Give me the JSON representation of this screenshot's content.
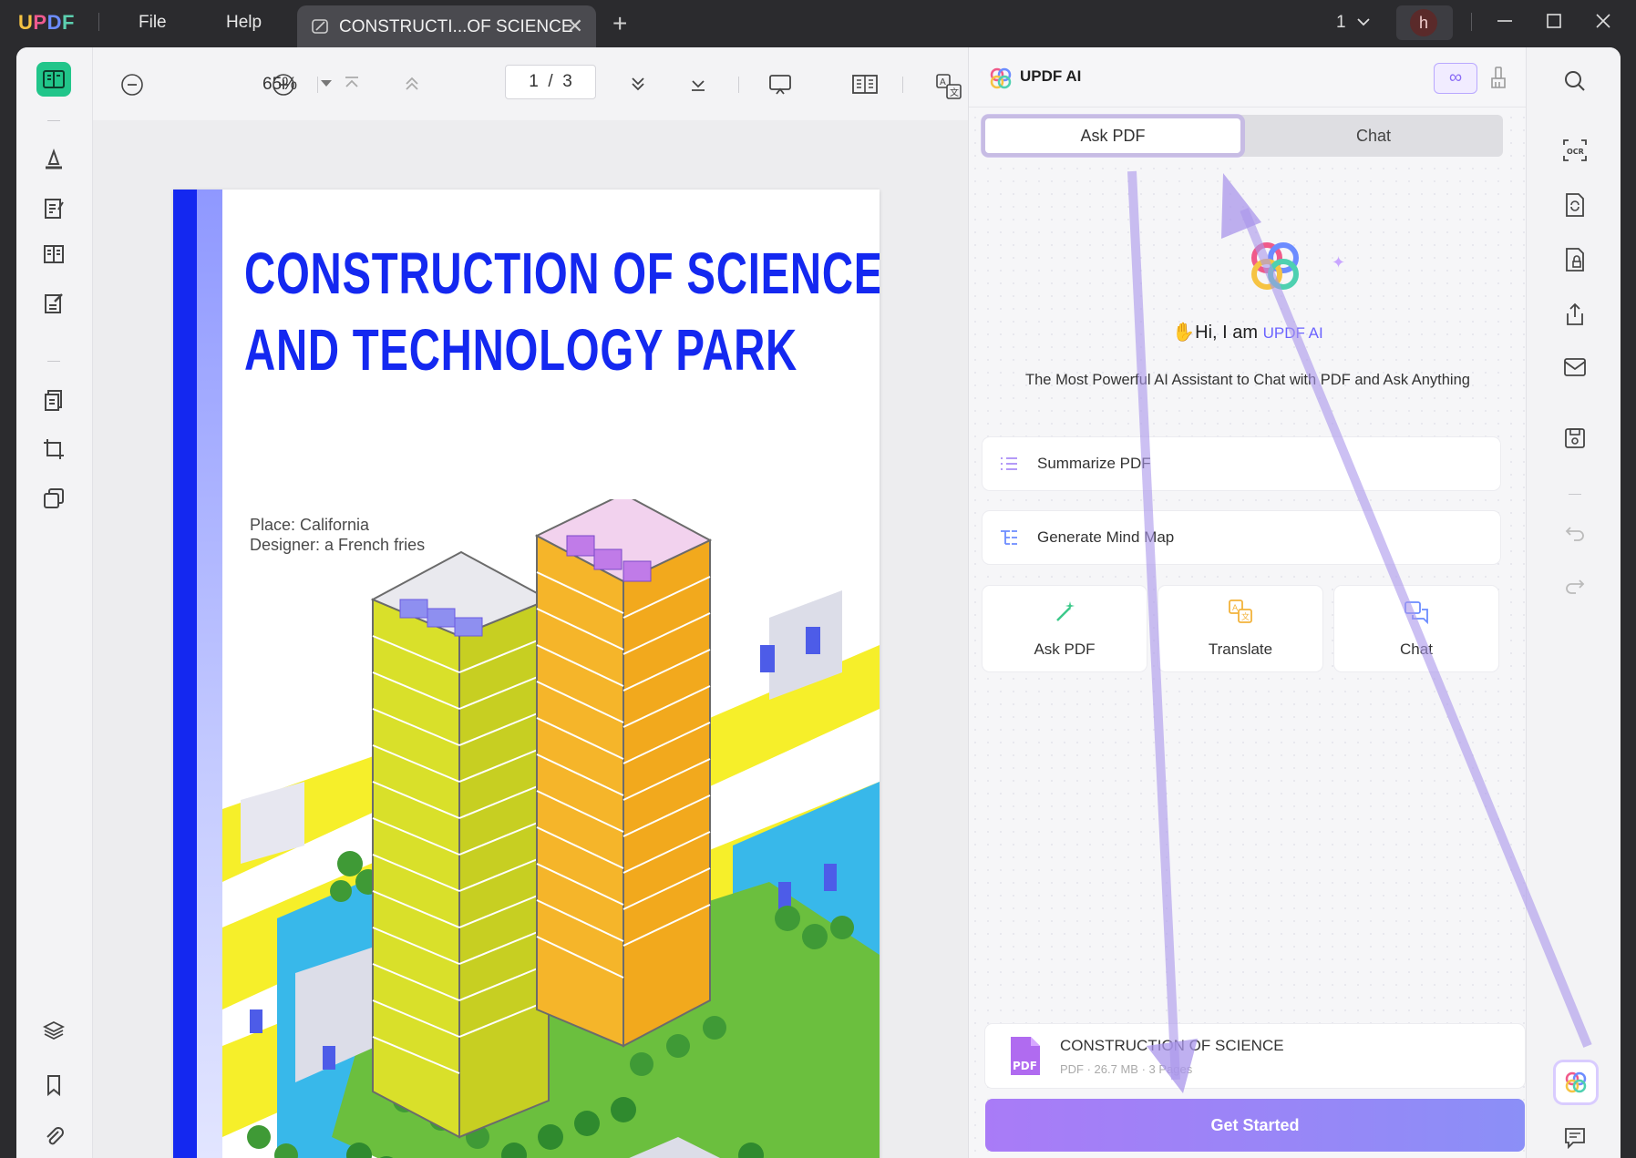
{
  "app": {
    "name": "UPDF"
  },
  "menu": {
    "file": "File",
    "help": "Help"
  },
  "tab": {
    "title": "CONSTRUCTI...OF SCIENCE",
    "close": "✕",
    "new_tab": "+"
  },
  "window": {
    "page_count": "1",
    "user_initial": "h"
  },
  "toolbar": {
    "zoom": "65%",
    "current_page": "1",
    "page_sep": "/",
    "total_pages": "3"
  },
  "document": {
    "title_line1": "CONSTRUCTION OF SCIENCE",
    "title_line2": "AND TECHNOLOGY PARK",
    "place": "Place:  California",
    "designer": "Designer: a French fries"
  },
  "ai_panel": {
    "title": "UPDF AI",
    "infinity": "∞",
    "tabs": [
      "Ask PDF",
      "Chat"
    ],
    "greeting_prefix": "Hi, I am",
    "greeting_brand": "UPDF AI",
    "subtitle": "The Most Powerful AI Assistant to Chat with PDF and Ask Anything",
    "actions": [
      "Summarize PDF",
      "Generate Mind Map"
    ],
    "cards": [
      "Ask PDF",
      "Translate",
      "Chat"
    ],
    "file": {
      "name": "CONSTRUCTION OF SCIENCE",
      "meta": "PDF · 26.7 MB · 3 Pages",
      "badge": "PDF"
    },
    "cta": "Get Started"
  },
  "colors": {
    "accent_green": "#21c58a",
    "doc_blue": "#1428f0",
    "ai_purple": "#8b6cf6"
  }
}
